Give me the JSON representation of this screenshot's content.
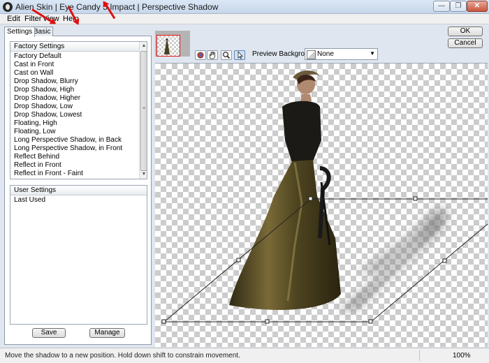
{
  "window": {
    "title": "Alien Skin | Eye Candy 5 Impact | Perspective Shadow",
    "controls": {
      "minimize": "—",
      "maximize": "❐",
      "close": "✕"
    }
  },
  "menu": {
    "items": [
      "Edit",
      "Filter",
      "View",
      "Help"
    ]
  },
  "tabs": {
    "settings": "Settings",
    "basic": "Basic"
  },
  "factory_settings": {
    "header": "Factory Settings",
    "items": [
      "Factory Default",
      "Cast in Front",
      "Cast on Wall",
      "Drop Shadow, Blurry",
      "Drop Shadow, High",
      "Drop Shadow, Higher",
      "Drop Shadow, Low",
      "Drop Shadow, Lowest",
      "Floating, High",
      "Floating, Low",
      "Long Perspective Shadow, in Back",
      "Long Perspective Shadow, in Front",
      "Reflect Behind",
      "Reflect in Front",
      "Reflect in Front - Faint"
    ]
  },
  "user_settings": {
    "header": "User Settings",
    "items": [
      "Last Used"
    ]
  },
  "buttons": {
    "save": "Save",
    "manage": "Manage",
    "ok": "OK",
    "cancel": "Cancel"
  },
  "preview": {
    "background_label": "Preview Background:",
    "background_value": "None"
  },
  "status": {
    "hint": "Move the shadow to a new position. Hold down shift to constrain movement.",
    "zoom": "100%"
  },
  "colors": {
    "annotation_arrow": "#e01010",
    "thumbnail_border": "#e01111"
  },
  "icons": {
    "tools": [
      "eyedropper-icon",
      "hand-icon",
      "zoom-icon",
      "arrow-pointer-icon"
    ],
    "scroll": {
      "up": "▲",
      "down": "▼",
      "grip": "≡"
    },
    "caret": "▼"
  }
}
